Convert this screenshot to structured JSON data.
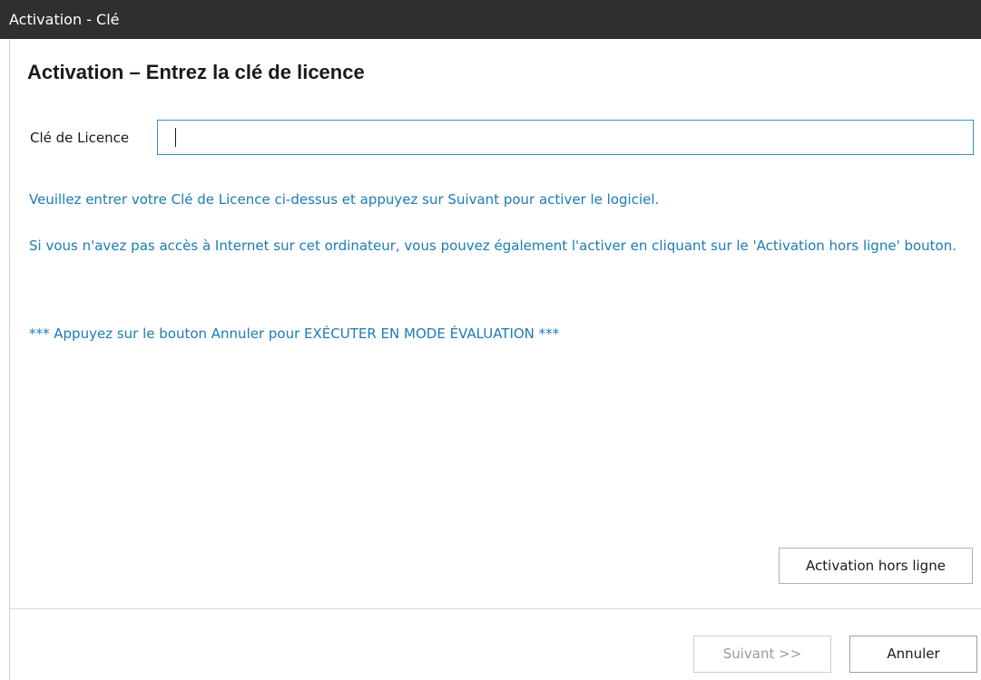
{
  "window": {
    "title": "Activation - Clé"
  },
  "main": {
    "heading": "Activation – Entrez la clé de licence",
    "license_label": "Clé de Licence",
    "license_value": "",
    "info_line1": "Veuillez entrer votre Clé de Licence ci-dessus et appuyez sur Suivant pour activer le logiciel.",
    "info_line2": "Si vous n'avez pas accès à Internet sur cet ordinateur, vous pouvez également l'activer en cliquant sur le 'Activation hors ligne' bouton.",
    "info_line3": "*** Appuyez sur le bouton Annuler pour EXÉCUTER EN MODE ÉVALUATION ***"
  },
  "buttons": {
    "offline_activation": "Activation hors ligne",
    "next": "Suivant >>",
    "cancel": "Annuler"
  },
  "colors": {
    "titlebar_bg": "#2f2f2f",
    "info_text": "#1c7bb5",
    "input_border": "#3b8ec8"
  }
}
